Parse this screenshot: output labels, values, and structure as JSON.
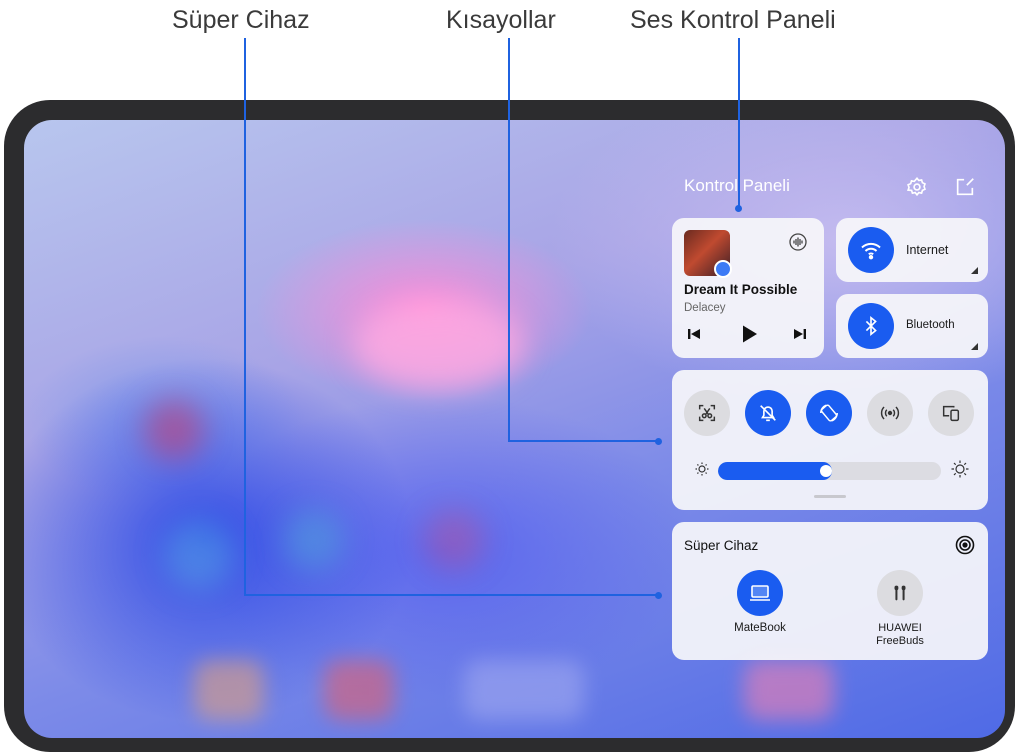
{
  "callouts": {
    "super_device": "Süper Cihaz",
    "shortcuts": "Kısayollar",
    "audio_panel": "Ses Kontrol Paneli"
  },
  "panel": {
    "title": "Kontrol Paneli",
    "icons": [
      "settings-icon",
      "edit-icon"
    ]
  },
  "music": {
    "song": "Dream It Possible",
    "artist": "Delacey",
    "controls": [
      "previous-icon",
      "play-icon",
      "next-icon"
    ]
  },
  "connectivity": {
    "internet_label": "Internet",
    "bluetooth_label": "Bluetooth"
  },
  "shortcuts": {
    "toggles": [
      {
        "name": "screenshot",
        "active": false
      },
      {
        "name": "silent",
        "active": true
      },
      {
        "name": "auto-rotate",
        "active": true
      },
      {
        "name": "hotspot",
        "active": false
      },
      {
        "name": "projection",
        "active": false
      }
    ],
    "brightness_level": 0.47
  },
  "super_device": {
    "title": "Süper Cihaz",
    "devices": [
      {
        "name": "MateBook",
        "icon": "laptop-icon",
        "active": true
      },
      {
        "name_line1": "HUAWEI",
        "name_line2": "FreeBuds",
        "icon": "earbuds-icon",
        "active": false
      }
    ]
  },
  "colors": {
    "accent": "#1a5cf0",
    "leader": "#1f62e0",
    "device_frame": "#2c2c2e"
  }
}
